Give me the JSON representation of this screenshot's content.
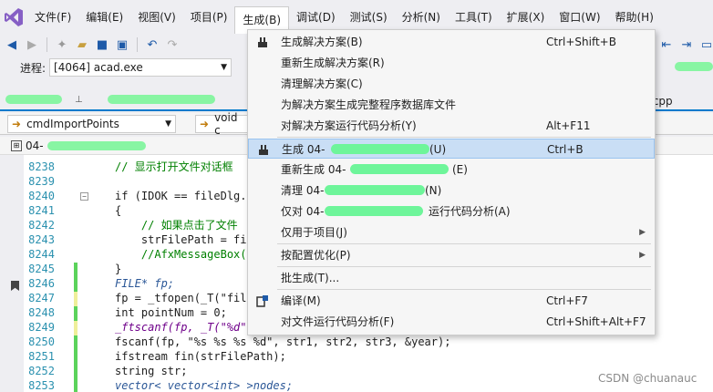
{
  "menubar": {
    "items": [
      "文件(F)",
      "编辑(E)",
      "视图(V)",
      "项目(P)",
      "生成(B)",
      "调试(D)",
      "测试(S)",
      "分析(N)",
      "工具(T)",
      "扩展(X)",
      "窗口(W)",
      "帮助(H)"
    ]
  },
  "process": {
    "label": "进程:",
    "value": "[4064] acad.exe"
  },
  "tabs": {
    "suffix": ".cpp"
  },
  "nav": {
    "left_combo": "cmdImportPoints",
    "right_combo": "void c"
  },
  "scope": {
    "value": "04-"
  },
  "build_menu": {
    "items": [
      {
        "label": "生成解决方案(B)",
        "shortcut": "Ctrl+Shift+B"
      },
      {
        "label": "重新生成解决方案(R)",
        "shortcut": ""
      },
      {
        "label": "清理解决方案(C)",
        "shortcut": ""
      },
      {
        "label": "为解决方案生成完整程序数据库文件",
        "shortcut": ""
      },
      {
        "label": "对解决方案运行代码分析(Y)",
        "shortcut": "Alt+F11"
      },
      {
        "label": "生成 04-",
        "tail": "(U)",
        "shortcut": "Ctrl+B"
      },
      {
        "label": "重新生成 04-",
        "tail": "(E)",
        "shortcut": ""
      },
      {
        "label": "清理 04-",
        "tail": "(N)",
        "shortcut": ""
      },
      {
        "label": "仅对 04-",
        "tail": "运行代码分析(A)",
        "shortcut": ""
      },
      {
        "label": "仅用于项目(J)",
        "shortcut": ""
      },
      {
        "label": "按配置优化(P)",
        "shortcut": ""
      },
      {
        "label": "批生成(T)...",
        "shortcut": ""
      },
      {
        "label": "编译(M)",
        "shortcut": "Ctrl+F7"
      },
      {
        "label": "对文件运行代码分析(F)",
        "shortcut": "Ctrl+Shift+Alt+F7"
      }
    ]
  },
  "editor": {
    "line_numbers": [
      "8238",
      "8239",
      "8240",
      "8241",
      "8242",
      "8243",
      "8244",
      "8245",
      "8246",
      "8247",
      "8248",
      "8249",
      "8250",
      "8251",
      "8252",
      "8253"
    ],
    "lines": [
      "// 显示打开文件对话框",
      "",
      "if (IDOK == fileDlg.D",
      "{",
      "    // 如果点击了文件",
      "    strFilePath = fil",
      "    //AfxMessageBox(s",
      "}",
      "FILE* fp;",
      "fp = _tfopen(_T(\"file",
      "int pointNum = 0;",
      "_ftscanf(fp, _T(\"%d\")",
      "fscanf(fp, \"%s %s %s %d\", str1, str2, str3, &year);",
      "ifstream fin(strFilePath);",
      "string str;",
      "vector< vector<int> >nodes;"
    ]
  },
  "watermark": "CSDN @chuanauc"
}
